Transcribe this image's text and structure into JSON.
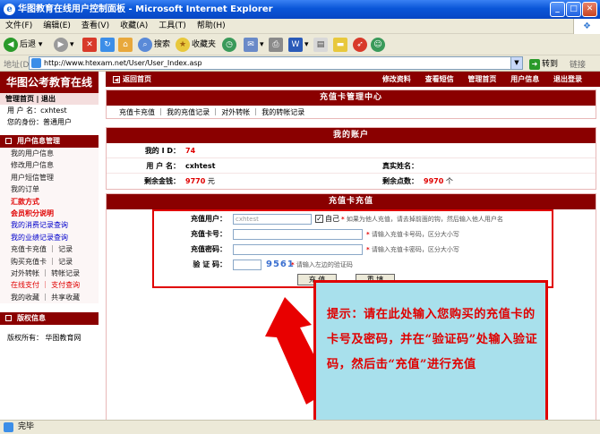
{
  "window": {
    "title": "华图教育在线用户控制面板 - Microsoft Internet Explorer"
  },
  "menu": [
    "文件(F)",
    "编辑(E)",
    "查看(V)",
    "收藏(A)",
    "工具(T)",
    "帮助(H)"
  ],
  "toolbar": {
    "back": "后退",
    "search": "搜索",
    "favorites": "收藏夹"
  },
  "address": {
    "label": "地址(D)",
    "url": "http://www.htexam.net/User/User_Index.asp",
    "go": "转到",
    "links": "链接"
  },
  "status": {
    "text": "完毕"
  },
  "sidebar": {
    "site_title": "华图公考教育在线",
    "nav_home": "管理首页",
    "nav_sep": "|",
    "nav_exit": "退出",
    "username_line": "用 户 名：cxhtest",
    "identity_line": "您的身份：普通用户",
    "section1": "用户信息管理",
    "items": [
      {
        "label": "我的用户信息",
        "style": "normal"
      },
      {
        "label": "修改用户信息",
        "style": "normal"
      },
      {
        "label": "用户短信管理",
        "style": "normal"
      },
      {
        "label": "我的订单",
        "style": "normal"
      },
      {
        "label": "汇款方式",
        "style": "red"
      },
      {
        "label": "会员积分说明",
        "style": "red"
      },
      {
        "label": "我的消费记录查询",
        "style": "blue"
      },
      {
        "label": "我的业绩记录查询",
        "style": "blue"
      },
      {
        "label": "充值卡充值 ｜ 记录",
        "style": "normal"
      },
      {
        "label": "购买充值卡 ｜ 记录",
        "style": "normal"
      },
      {
        "label": "对外转帐 ｜ 转帐记录",
        "style": "normal"
      },
      {
        "label": "在线支付 ｜ 支付查询",
        "style": "redtext"
      },
      {
        "label": "我的收藏 ｜ 共享收藏",
        "style": "normal"
      }
    ],
    "section2": "版权信息",
    "copyright": "版权所有： 华图教育网"
  },
  "topnav": {
    "back": "返回首页",
    "links": [
      "修改资料",
      "查看短信",
      "管理首页",
      "用户信息",
      "退出登录"
    ]
  },
  "card_center": {
    "title": "充值卡管理中心",
    "links": [
      "充值卡充值",
      "我的充值记录",
      "对外转帐",
      "我的转帐记录"
    ]
  },
  "account": {
    "title": "我的账户",
    "id_label": "我的 I D：",
    "id_value": "74",
    "username_label": "用 户 名：",
    "username_value": "cxhtest",
    "realname_label": "真实姓名：",
    "realname_value": "",
    "balance_label": "剩余金钱：",
    "balance_value": "9770",
    "balance_unit": "元",
    "points_label": "剩余点数：",
    "points_value": "9970",
    "points_unit": "个"
  },
  "recharge": {
    "title": "充值卡充值",
    "user_label": "充值用户：",
    "user_value": "cxhtest",
    "self_label": "自己",
    "user_hint": "如果为他人充值，请去掉前面的钩，然后输入他人用户名",
    "card_label": "充值卡号：",
    "card_hint": "请输入充值卡号码，区分大小写",
    "pwd_label": "充值密码：",
    "pwd_hint": "请输入充值卡密码，区分大小写",
    "code_label": "验 证 码：",
    "code_value": "9561",
    "code_hint": "请输入左边的验证码",
    "submit": "充 值",
    "reset": "重 填",
    "required_mark": "*"
  },
  "annotation": {
    "text": "提示：请在此处输入您购买的充值卡的卡号及密码，并在“验证码”处输入验证码，然后击“充值”进行充值"
  }
}
